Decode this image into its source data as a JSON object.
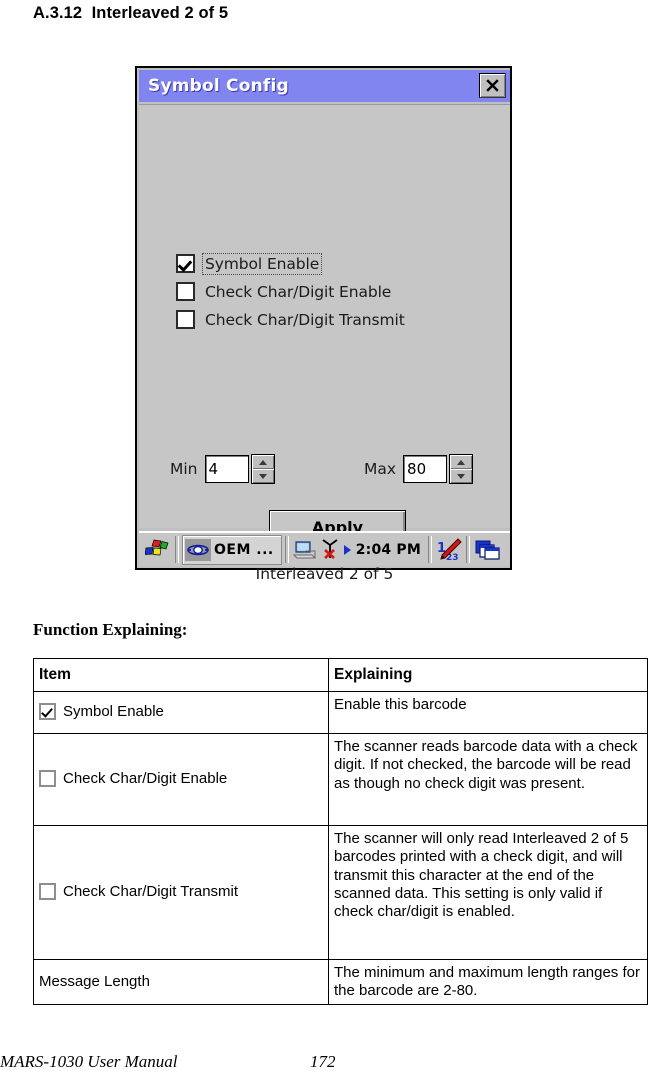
{
  "page": {
    "heading": "A.3.12  Interleaved 2 of 5",
    "function_title": "Function Explaining:",
    "footer_left": "MARS-1030 User Manual",
    "footer_page": "172"
  },
  "dialog": {
    "title": "Symbol Config",
    "close_label": "×",
    "titlebar_color": "#8085ef",
    "client_color": "#c6c6c6",
    "checkboxes": [
      {
        "label": "Symbol Enable",
        "checked": true,
        "focused": true
      },
      {
        "label": "Check Char/Digit Enable",
        "checked": false,
        "focused": false
      },
      {
        "label": "Check Char/Digit Transmit",
        "checked": false,
        "focused": false
      }
    ],
    "min": {
      "label": "Min",
      "value": "4"
    },
    "max": {
      "label": "Max",
      "value": "80"
    },
    "apply_label": "Apply",
    "symbology_name": "Interleaved 2 of 5"
  },
  "taskbar": {
    "start_icon": "windows-ce-flag-icon",
    "task_button": {
      "label": "OEM ...",
      "icon": "oem-lens-icon"
    },
    "tray": [
      {
        "icon": "network-pc-icon"
      },
      {
        "icon": "antenna-disconnected-icon"
      },
      {
        "icon": "play-arrow-icon"
      }
    ],
    "clock": "2:04 PM",
    "sip_icon": "input-panel-pen-icon",
    "desktop_icon": "show-desktop-icon"
  },
  "table": {
    "headers": [
      "Item",
      "Explaining"
    ],
    "rows": [
      {
        "item": "Symbol Enable",
        "checkbox": "checked",
        "indent": 0,
        "explaining": "Enable this barcode"
      },
      {
        "item": "Check Char/Digit Enable",
        "checkbox": "unchecked",
        "indent": 1,
        "explaining": "The scanner reads barcode data with a check digit. If not checked, the barcode will be read as though no check digit was present."
      },
      {
        "item": "Check Char/Digit Transmit",
        "checkbox": "unchecked",
        "indent": 2,
        "explaining": "The scanner will only read Interleaved 2 of 5 barcodes printed with a check digit, and will transmit this character at the end of the scanned data. This setting is only valid if check char/digit is enabled."
      },
      {
        "item": "Message Length",
        "checkbox": "none",
        "indent": 0,
        "explaining": "The minimum and maximum length ranges for the barcode are 2-80."
      }
    ]
  }
}
